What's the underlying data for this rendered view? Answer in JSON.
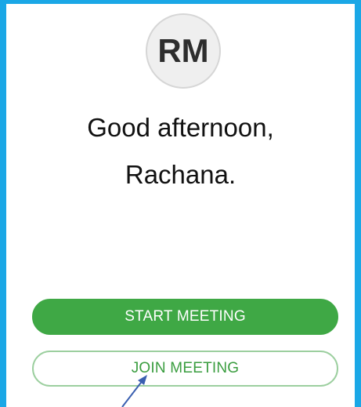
{
  "user": {
    "initials": "RM"
  },
  "greeting": {
    "line1": "Good afternoon,",
    "line2": "Rachana."
  },
  "actions": {
    "start_label": "START MEETING",
    "join_label": "JOIN MEETING"
  },
  "colors": {
    "frame": "#1aa7e6",
    "primary_green": "#3fa845",
    "join_border": "#9ccf9f",
    "arrow": "#3a5fb0"
  }
}
